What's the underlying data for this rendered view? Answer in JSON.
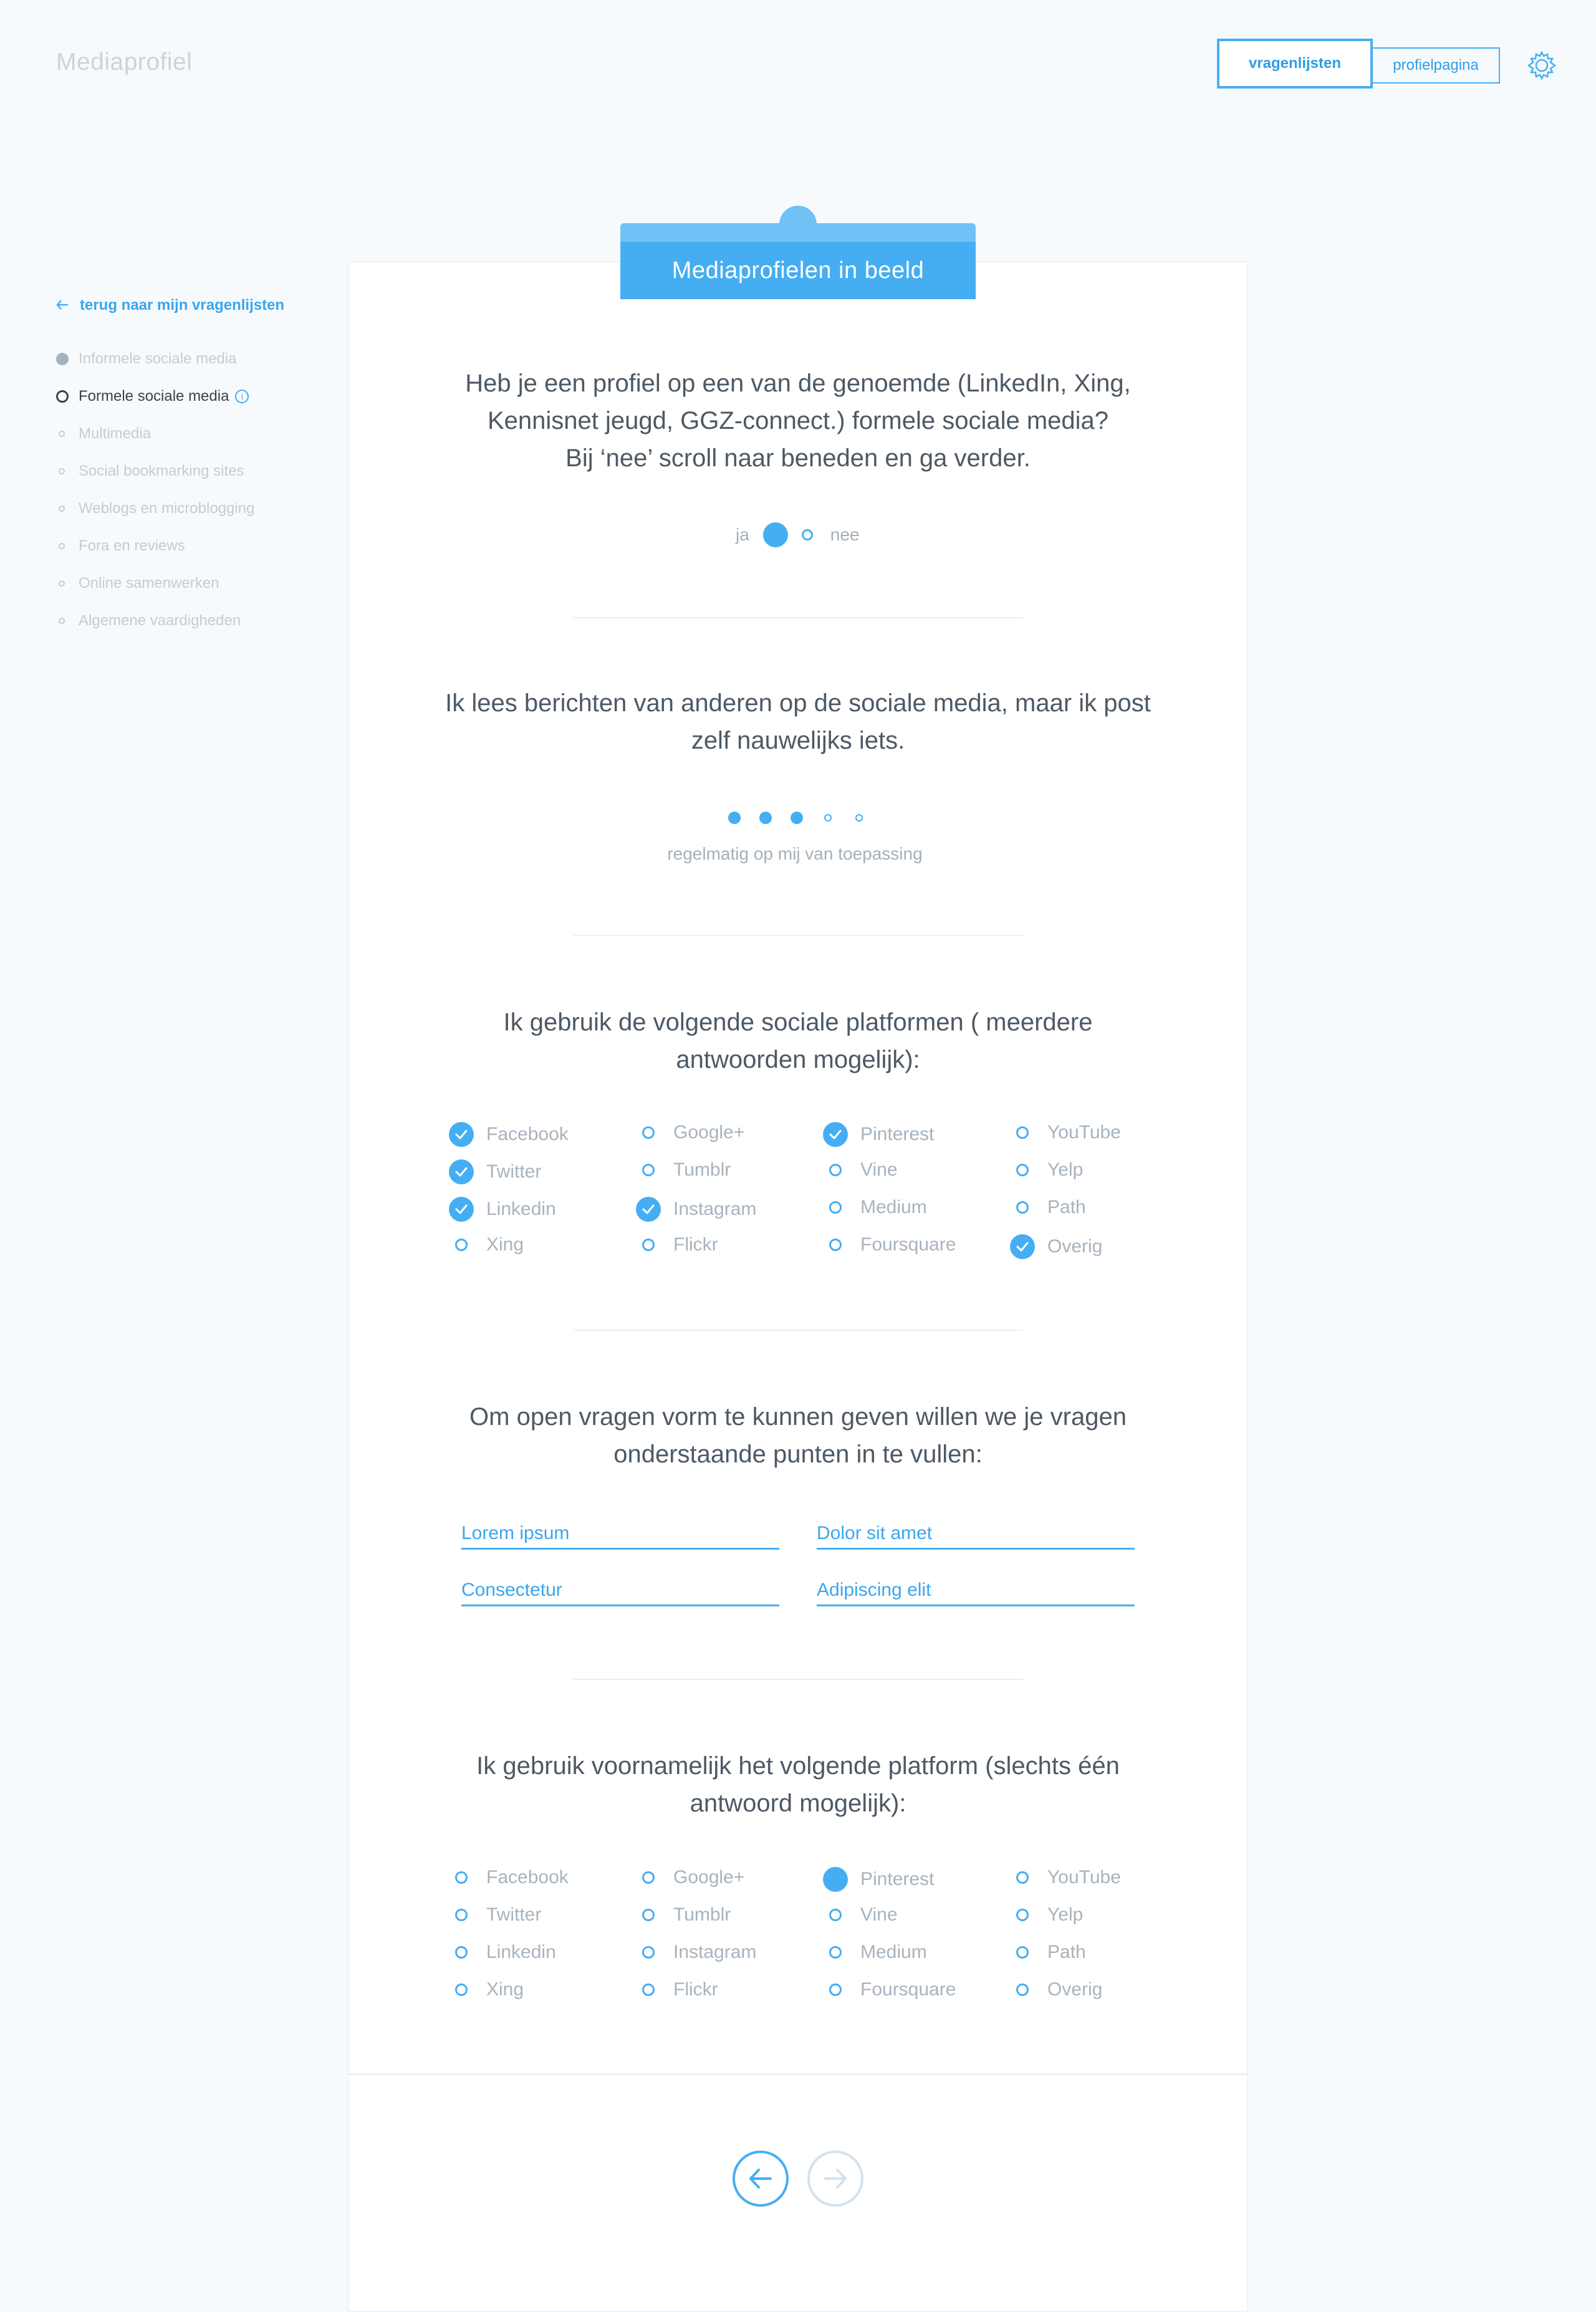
{
  "app": {
    "title": "Mediaprofiel"
  },
  "nav": {
    "primary": "vragenlijsten",
    "secondary": "profielpagina"
  },
  "sidebar": {
    "back_label": "terug naar mijn vragenlijsten",
    "items": [
      {
        "label": "Informele sociale media",
        "state": "done"
      },
      {
        "label": "Formele sociale media",
        "state": "active"
      },
      {
        "label": "Multimedia",
        "state": "todo"
      },
      {
        "label": "Social bookmarking sites",
        "state": "todo"
      },
      {
        "label": "Weblogs en microblogging",
        "state": "todo"
      },
      {
        "label": "Fora en reviews",
        "state": "todo"
      },
      {
        "label": "Online samenwerken",
        "state": "todo"
      },
      {
        "label": "Algemene vaardigheden",
        "state": "todo"
      }
    ]
  },
  "card": {
    "tab_title": "Mediaprofielen in beeld"
  },
  "q1": {
    "lines": [
      "Heb je een profiel op een van de genoemde (LinkedIn, Xing,",
      "Kennisnet jeugd, GGZ-connect.) formele sociale media?",
      "Bij ‘nee’ scroll naar beneden en ga verder."
    ],
    "yes": "ja",
    "no": "nee",
    "selected": "ja"
  },
  "q2": {
    "lines": [
      "Ik lees berichten van anderen op de sociale media, maar ik post",
      "zelf nauwelijks iets."
    ],
    "scale_value": 3,
    "scale_max": 5,
    "scale_label": "regelmatig op mij van toepassing"
  },
  "q3": {
    "lines": [
      "Ik gebruik de volgende sociale platformen ( meerdere",
      "antwoorden mogelijk):"
    ],
    "columns": [
      [
        {
          "label": "Facebook",
          "checked": true
        },
        {
          "label": "Twitter",
          "checked": true
        },
        {
          "label": "Linkedin",
          "checked": true
        },
        {
          "label": "Xing",
          "checked": false
        }
      ],
      [
        {
          "label": "Google+",
          "checked": false
        },
        {
          "label": "Tumblr",
          "checked": false
        },
        {
          "label": "Instagram",
          "checked": true
        },
        {
          "label": "Flickr",
          "checked": false
        }
      ],
      [
        {
          "label": "Pinterest",
          "checked": true
        },
        {
          "label": "Vine",
          "checked": false
        },
        {
          "label": "Medium",
          "checked": false
        },
        {
          "label": "Foursquare",
          "checked": false
        }
      ],
      [
        {
          "label": "YouTube",
          "checked": false
        },
        {
          "label": "Yelp",
          "checked": false
        },
        {
          "label": "Path",
          "checked": false
        },
        {
          "label": "Overig",
          "checked": true
        }
      ]
    ]
  },
  "q4": {
    "lines": [
      "Om open vragen vorm te kunnen geven willen we je vragen",
      "onderstaande punten in te vullen:"
    ],
    "fields": [
      "Lorem ipsum",
      "Dolor sit amet",
      "Consectetur",
      "Adipiscing elit"
    ]
  },
  "q5": {
    "lines": [
      "Ik gebruik voornamelijk het volgende platform (slechts één",
      "antwoord mogelijk):"
    ],
    "selected": "Pinterest",
    "columns": [
      [
        "Facebook",
        "Twitter",
        "Linkedin",
        "Xing"
      ],
      [
        "Google+",
        "Tumblr",
        "Instagram",
        "Flickr"
      ],
      [
        "Pinterest",
        "Vine",
        "Medium",
        "Foursquare"
      ],
      [
        "YouTube",
        "Yelp",
        "Path",
        "Overig"
      ]
    ]
  },
  "colors": {
    "accent": "#45aef2",
    "muted": "#a7b3be",
    "text": "#4d5964",
    "background": "#f6fafd"
  }
}
